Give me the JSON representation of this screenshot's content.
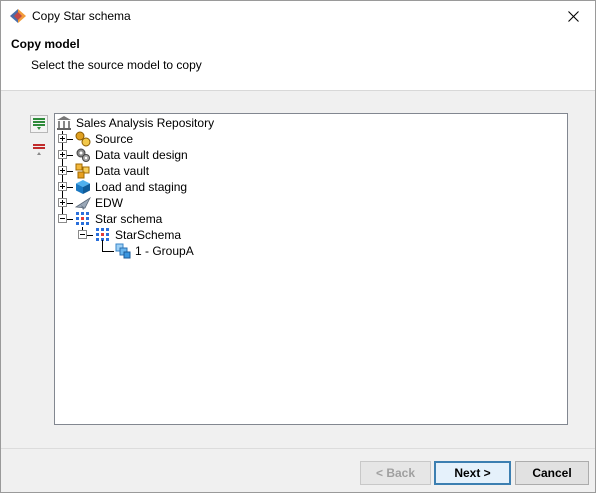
{
  "window": {
    "title": "Copy Star schema"
  },
  "header": {
    "title": "Copy model",
    "subtitle": "Select the source model to copy"
  },
  "toolbar": {
    "expand_icon": "expand-all-icon",
    "collapse_icon": "collapse-all-icon"
  },
  "tree": {
    "root": {
      "label": "Sales Analysis Repository",
      "icon": "repository-icon"
    },
    "items": [
      {
        "label": "Source",
        "icon": "source-keys-icon",
        "state": "collapsed"
      },
      {
        "label": "Data vault design",
        "icon": "gears-icon",
        "state": "collapsed"
      },
      {
        "label": "Data vault",
        "icon": "cubes-icon",
        "state": "collapsed"
      },
      {
        "label": "Load and staging",
        "icon": "blue-cube-icon",
        "state": "collapsed"
      },
      {
        "label": "EDW",
        "icon": "plane-icon",
        "state": "collapsed"
      },
      {
        "label": "Star schema",
        "icon": "grid-dots-icon",
        "state": "expanded"
      }
    ],
    "star_child": {
      "label": "StarSchema",
      "icon": "grid-dots-icon",
      "state": "expanded"
    },
    "group_child": {
      "label": "1 - GroupA",
      "icon": "group-cubes-icon"
    }
  },
  "footer": {
    "back_label": "< Back",
    "next_label": "Next >",
    "cancel_label": "Cancel"
  },
  "colors": {
    "next_border": "#3c7fb1",
    "next_bg": "#e5f1fb",
    "tree_border": "#828790"
  }
}
